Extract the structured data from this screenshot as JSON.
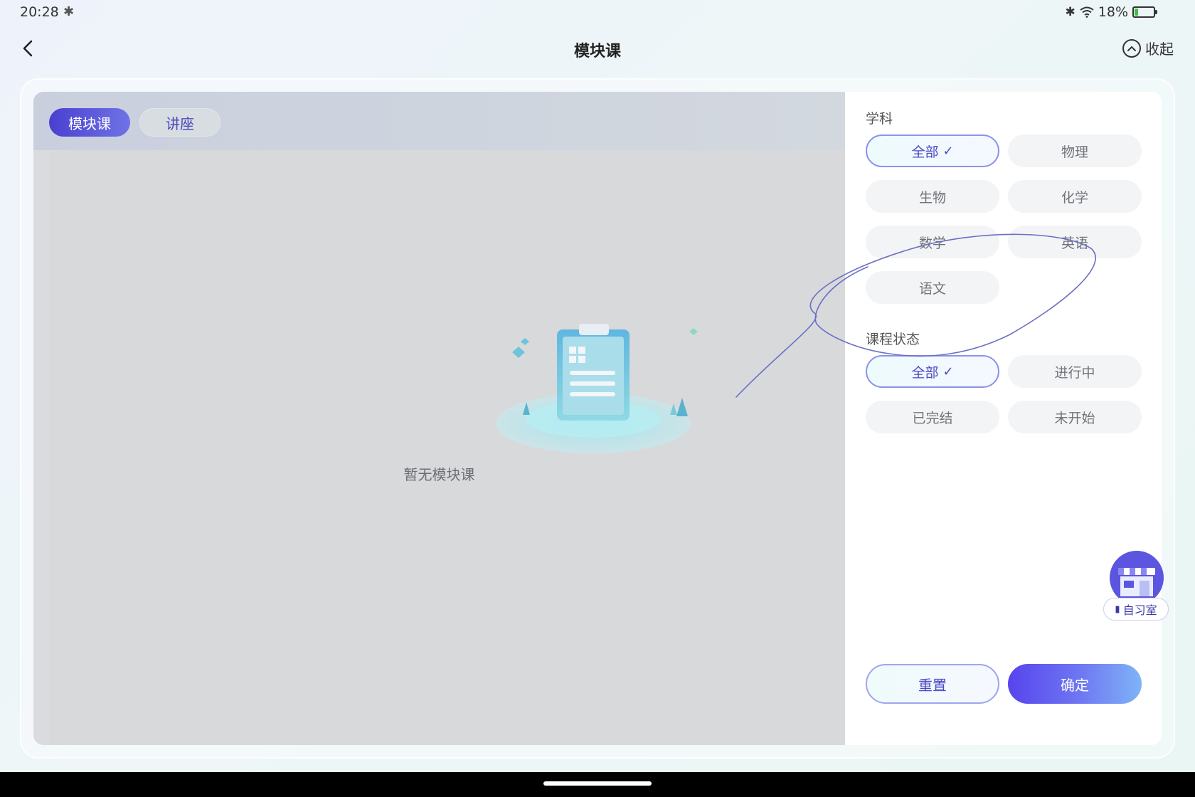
{
  "status_bar": {
    "time": "20:28",
    "battery": "18%",
    "battery_level": 0.18
  },
  "header": {
    "title": "模块课",
    "collapse_label": "收起"
  },
  "tabs": [
    {
      "label": "模块课",
      "active": true
    },
    {
      "label": "讲座",
      "active": false
    }
  ],
  "empty_state": {
    "text": "暂无模块课"
  },
  "filters": {
    "subject_label": "学科",
    "subjects": [
      "全部",
      "物理",
      "生物",
      "化学",
      "数学",
      "英语",
      "语文"
    ],
    "subject_selected": "全部",
    "status_label": "课程状态",
    "statuses": [
      "全部",
      "进行中",
      "已完结",
      "未开始"
    ],
    "status_selected": "全部",
    "check_mark": "✓"
  },
  "actions": {
    "reset_label": "重置",
    "confirm_label": "确定"
  },
  "floating": {
    "study_room_label": "自习室"
  },
  "colors": {
    "accent": "#4b47c6",
    "primary_gradient_start": "#5744ee",
    "primary_gradient_end": "#7fb4f7"
  }
}
